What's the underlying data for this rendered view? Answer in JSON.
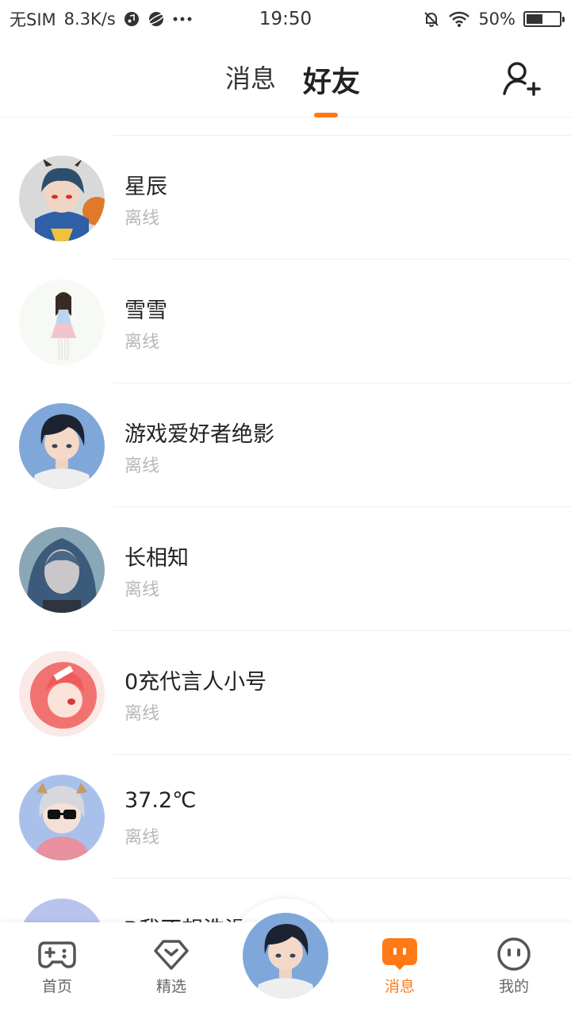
{
  "status_bar": {
    "carrier": "无SIM",
    "speed": "8.3K/s",
    "time": "19:50",
    "battery": "50%"
  },
  "header": {
    "tabs": [
      {
        "label": "消息",
        "active": false
      },
      {
        "label": "好友",
        "active": true
      }
    ],
    "accent_color": "#ff7a17"
  },
  "friends": [
    {
      "name": "星辰",
      "status": "离线"
    },
    {
      "name": "雪雪",
      "status": "离线"
    },
    {
      "name": "游戏爱好者绝影",
      "status": "离线"
    },
    {
      "name": "长相知",
      "status": "离线"
    },
    {
      "name": "0充代言人小号",
      "status": "离线"
    },
    {
      "name": "37.2℃",
      "status": "离线"
    },
    {
      "name": "Ꭰ我不想洗澡",
      "status": ""
    }
  ],
  "bottom_nav": {
    "items": [
      {
        "label": "首页",
        "icon": "gamepad-icon",
        "active": false
      },
      {
        "label": "精选",
        "icon": "heart-diamond-icon",
        "active": false
      },
      {
        "label": "消息",
        "icon": "chat-bubble-icon",
        "active": true
      },
      {
        "label": "我的",
        "icon": "face-icon",
        "active": false
      }
    ]
  }
}
